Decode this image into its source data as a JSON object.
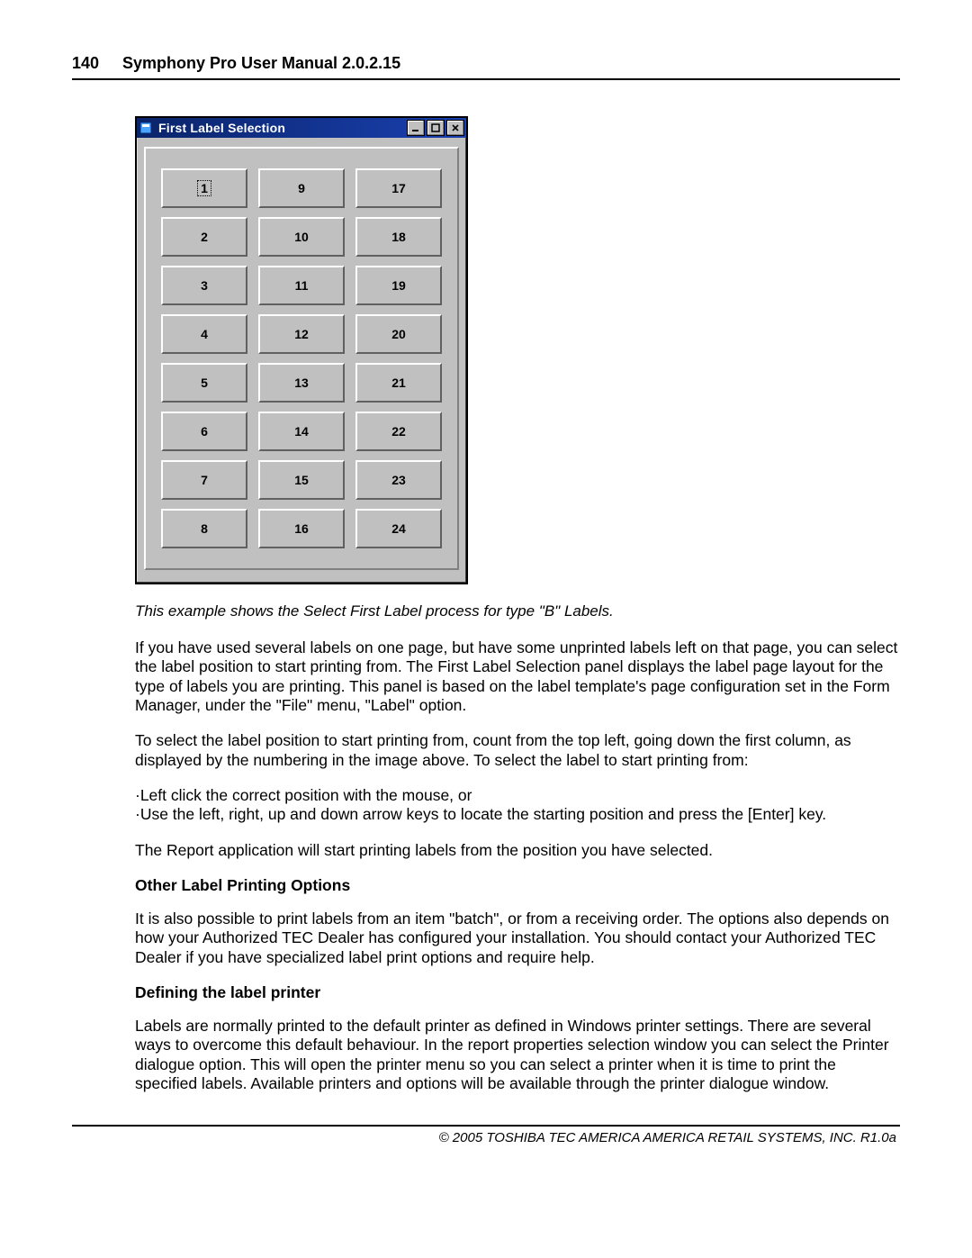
{
  "header": {
    "page_number": "140",
    "doc_title": "Symphony Pro User Manual  2.0.2.15"
  },
  "dialog": {
    "title": "First Label Selection",
    "selected_index": 0,
    "buttons": [
      "1",
      "2",
      "3",
      "4",
      "5",
      "6",
      "7",
      "8",
      "9",
      "10",
      "11",
      "12",
      "13",
      "14",
      "15",
      "16",
      "17",
      "18",
      "19",
      "20",
      "21",
      "22",
      "23",
      "24"
    ]
  },
  "caption": "This example shows the Select First Label process for type \"B\" Labels.",
  "paragraphs": {
    "p1": " If you have used several labels on one page, but have some unprinted labels left on that page, you can select the label position to start printing from. The First Label Selection panel displays the label page layout for the type of labels you are printing. This panel is based on the label template's page configuration set in the Form Manager, under the \"File\" menu, \"Label\" option.",
    "p2": " To select the label position to start printing from, count from the top left, going down the first column, as displayed by the numbering in the image above. To select the label to start printing from:",
    "bullets": [
      "·Left click the correct position with the mouse, or",
      "·Use the left, right, up and down arrow keys to locate the starting position and press the [Enter] key."
    ],
    "p3": " The Report application will start printing labels from the position you have selected.",
    "h1": "Other Label Printing Options",
    "p4": " It is also possible to print labels from an item \"batch\", or from a receiving order. The options also depends on how your Authorized TEC Dealer has configured your installation. You should contact your Authorized TEC Dealer if you have specialized label print options and require help.",
    "h2": "Defining the label printer",
    "p5": "Labels are normally printed to the default printer as defined in Windows printer settings. There are several ways to overcome this default behaviour. In the report properties selection window you can select the Printer dialogue option. This will open the printer menu so you can select a printer when it is time to print the specified labels. Available printers and options will be available through the printer dialogue window."
  },
  "footer": "© 2005 TOSHIBA TEC AMERICA AMERICA RETAIL SYSTEMS, INC.   R1.0a"
}
